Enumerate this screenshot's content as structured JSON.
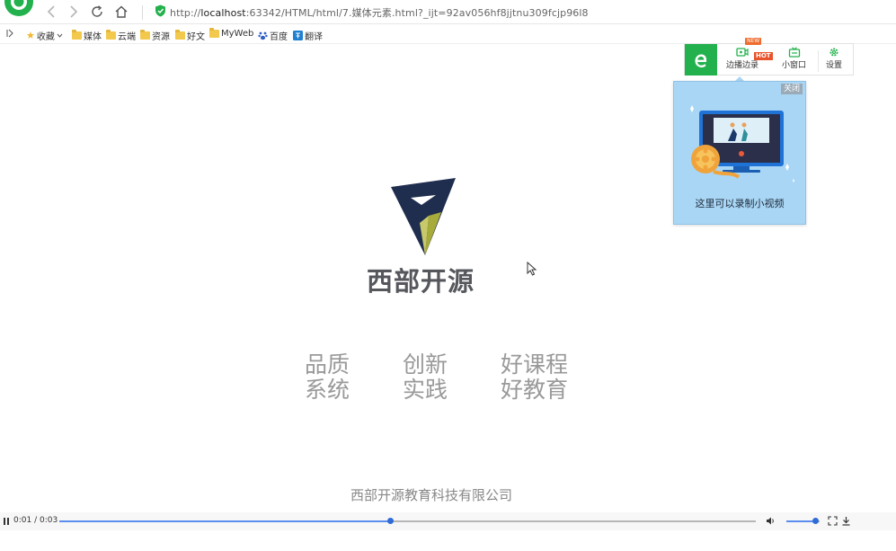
{
  "browser": {
    "url_prefix": "http://",
    "url_host": "localhost",
    "url_rest": ":63342/HTML/html/7.媒体元素.html?_ijt=92av056hf8jjtnu309fcjp96l8",
    "bookmarks": [
      {
        "label": "收藏",
        "icon": "star-icon",
        "has_dropdown": true
      },
      {
        "label": "媒体",
        "icon": "folder-icon"
      },
      {
        "label": "云端",
        "icon": "folder-icon"
      },
      {
        "label": "资源",
        "icon": "folder-icon"
      },
      {
        "label": "好文",
        "icon": "folder-icon"
      },
      {
        "label": "MyWeb",
        "icon": "folder-icon"
      },
      {
        "label": "百度",
        "icon": "baidu-paw-icon"
      },
      {
        "label": "翻译",
        "icon": "translate-icon"
      }
    ]
  },
  "video_toolbar": {
    "record_label": "边播边录",
    "badge_new": "NEW",
    "badge_hot": "HOT",
    "mini_window_label": "小窗口",
    "settings_label": "设置"
  },
  "popup": {
    "close_label": "关闭",
    "message": "这里可以录制小视频"
  },
  "content": {
    "brand_name": "西部开源",
    "slogans": [
      [
        "品质",
        "系统"
      ],
      [
        "创新",
        "实践"
      ],
      [
        "好课程",
        "好教育"
      ]
    ],
    "company": "西部开源教育科技有限公司"
  },
  "player": {
    "time_display": "0:01 / 0:03",
    "progress_fraction": 0.4745,
    "volume_fraction": 0.9,
    "accent": "#2f6bd6"
  },
  "colors": {
    "brand_green": "#22b14c",
    "logo_navy": "#1f2d4e",
    "logo_olive": "#a7ab3a"
  }
}
